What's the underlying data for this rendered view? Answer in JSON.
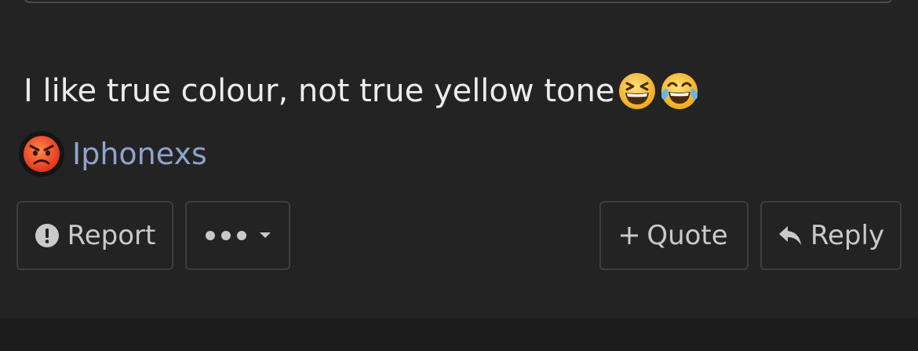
{
  "post": {
    "message": "I like true colour, not true yellow tone",
    "message_emojis": [
      "grinning-squinting-face-emoji",
      "tears-of-joy-emoji"
    ],
    "signature": {
      "avatar_emoji": "angry-face-emoji",
      "username": "Iphonexs"
    }
  },
  "actions": {
    "report_label": "Report",
    "report_icon": "exclamation-circle-icon",
    "more_icon": "ellipsis-dropdown-icon",
    "quote_label": "Quote",
    "quote_icon": "plus-icon",
    "reply_label": "Reply",
    "reply_icon": "reply-arrow-icon"
  },
  "colors": {
    "background": "#232323",
    "text": "#ececec",
    "username": "#8fa3cb",
    "button_text": "#c9c9c9",
    "button_border": "#3e3e3e"
  }
}
